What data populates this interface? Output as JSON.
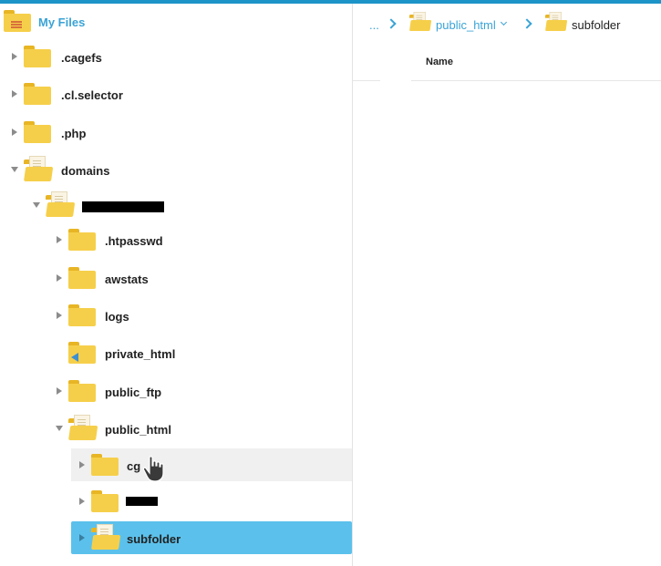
{
  "colors": {
    "accent": "#3aa3d6",
    "selected_bg": "#5bc1ec",
    "hover_bg": "#f0f0f0",
    "folder": "#f6cf4a"
  },
  "tree": {
    "root_label": "My Files",
    "items": [
      {
        "label": ".cagefs"
      },
      {
        "label": ".cl.selector"
      },
      {
        "label": ".php"
      },
      {
        "label": "domains"
      },
      {
        "label": ""
      },
      {
        "label": ".htpasswd"
      },
      {
        "label": "awstats"
      },
      {
        "label": "logs"
      },
      {
        "label": "private_html"
      },
      {
        "label": "public_ftp"
      },
      {
        "label": "public_html"
      },
      {
        "label": "cg"
      },
      {
        "label": ""
      },
      {
        "label": "subfolder"
      }
    ]
  },
  "breadcrumb": {
    "ellipsis": "...",
    "items": [
      {
        "label": "public_html",
        "icon": "folder-open-icon",
        "has_dropdown": true
      },
      {
        "label": "subfolder",
        "icon": "folder-open-icon"
      }
    ]
  },
  "file_list": {
    "columns": [
      "Name"
    ]
  }
}
